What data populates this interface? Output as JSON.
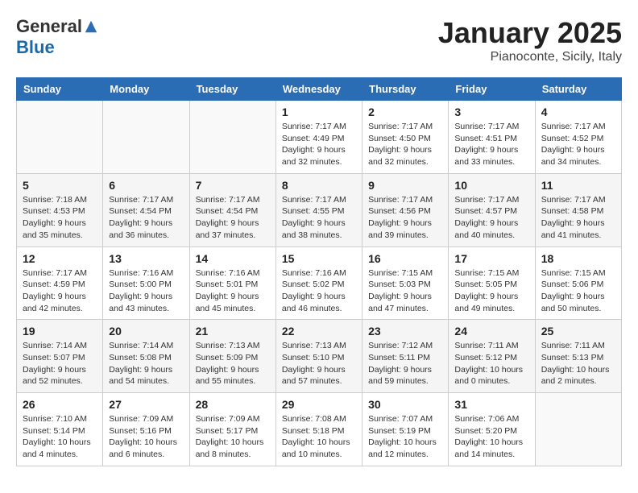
{
  "logo": {
    "general": "General",
    "blue": "Blue"
  },
  "title": "January 2025",
  "subtitle": "Pianoconte, Sicily, Italy",
  "days_of_week": [
    "Sunday",
    "Monday",
    "Tuesday",
    "Wednesday",
    "Thursday",
    "Friday",
    "Saturday"
  ],
  "weeks": [
    [
      {
        "day": "",
        "info": ""
      },
      {
        "day": "",
        "info": ""
      },
      {
        "day": "",
        "info": ""
      },
      {
        "day": "1",
        "info": "Sunrise: 7:17 AM\nSunset: 4:49 PM\nDaylight: 9 hours\nand 32 minutes."
      },
      {
        "day": "2",
        "info": "Sunrise: 7:17 AM\nSunset: 4:50 PM\nDaylight: 9 hours\nand 32 minutes."
      },
      {
        "day": "3",
        "info": "Sunrise: 7:17 AM\nSunset: 4:51 PM\nDaylight: 9 hours\nand 33 minutes."
      },
      {
        "day": "4",
        "info": "Sunrise: 7:17 AM\nSunset: 4:52 PM\nDaylight: 9 hours\nand 34 minutes."
      }
    ],
    [
      {
        "day": "5",
        "info": "Sunrise: 7:18 AM\nSunset: 4:53 PM\nDaylight: 9 hours\nand 35 minutes."
      },
      {
        "day": "6",
        "info": "Sunrise: 7:17 AM\nSunset: 4:54 PM\nDaylight: 9 hours\nand 36 minutes."
      },
      {
        "day": "7",
        "info": "Sunrise: 7:17 AM\nSunset: 4:54 PM\nDaylight: 9 hours\nand 37 minutes."
      },
      {
        "day": "8",
        "info": "Sunrise: 7:17 AM\nSunset: 4:55 PM\nDaylight: 9 hours\nand 38 minutes."
      },
      {
        "day": "9",
        "info": "Sunrise: 7:17 AM\nSunset: 4:56 PM\nDaylight: 9 hours\nand 39 minutes."
      },
      {
        "day": "10",
        "info": "Sunrise: 7:17 AM\nSunset: 4:57 PM\nDaylight: 9 hours\nand 40 minutes."
      },
      {
        "day": "11",
        "info": "Sunrise: 7:17 AM\nSunset: 4:58 PM\nDaylight: 9 hours\nand 41 minutes."
      }
    ],
    [
      {
        "day": "12",
        "info": "Sunrise: 7:17 AM\nSunset: 4:59 PM\nDaylight: 9 hours\nand 42 minutes."
      },
      {
        "day": "13",
        "info": "Sunrise: 7:16 AM\nSunset: 5:00 PM\nDaylight: 9 hours\nand 43 minutes."
      },
      {
        "day": "14",
        "info": "Sunrise: 7:16 AM\nSunset: 5:01 PM\nDaylight: 9 hours\nand 45 minutes."
      },
      {
        "day": "15",
        "info": "Sunrise: 7:16 AM\nSunset: 5:02 PM\nDaylight: 9 hours\nand 46 minutes."
      },
      {
        "day": "16",
        "info": "Sunrise: 7:15 AM\nSunset: 5:03 PM\nDaylight: 9 hours\nand 47 minutes."
      },
      {
        "day": "17",
        "info": "Sunrise: 7:15 AM\nSunset: 5:05 PM\nDaylight: 9 hours\nand 49 minutes."
      },
      {
        "day": "18",
        "info": "Sunrise: 7:15 AM\nSunset: 5:06 PM\nDaylight: 9 hours\nand 50 minutes."
      }
    ],
    [
      {
        "day": "19",
        "info": "Sunrise: 7:14 AM\nSunset: 5:07 PM\nDaylight: 9 hours\nand 52 minutes."
      },
      {
        "day": "20",
        "info": "Sunrise: 7:14 AM\nSunset: 5:08 PM\nDaylight: 9 hours\nand 54 minutes."
      },
      {
        "day": "21",
        "info": "Sunrise: 7:13 AM\nSunset: 5:09 PM\nDaylight: 9 hours\nand 55 minutes."
      },
      {
        "day": "22",
        "info": "Sunrise: 7:13 AM\nSunset: 5:10 PM\nDaylight: 9 hours\nand 57 minutes."
      },
      {
        "day": "23",
        "info": "Sunrise: 7:12 AM\nSunset: 5:11 PM\nDaylight: 9 hours\nand 59 minutes."
      },
      {
        "day": "24",
        "info": "Sunrise: 7:11 AM\nSunset: 5:12 PM\nDaylight: 10 hours\nand 0 minutes."
      },
      {
        "day": "25",
        "info": "Sunrise: 7:11 AM\nSunset: 5:13 PM\nDaylight: 10 hours\nand 2 minutes."
      }
    ],
    [
      {
        "day": "26",
        "info": "Sunrise: 7:10 AM\nSunset: 5:14 PM\nDaylight: 10 hours\nand 4 minutes."
      },
      {
        "day": "27",
        "info": "Sunrise: 7:09 AM\nSunset: 5:16 PM\nDaylight: 10 hours\nand 6 minutes."
      },
      {
        "day": "28",
        "info": "Sunrise: 7:09 AM\nSunset: 5:17 PM\nDaylight: 10 hours\nand 8 minutes."
      },
      {
        "day": "29",
        "info": "Sunrise: 7:08 AM\nSunset: 5:18 PM\nDaylight: 10 hours\nand 10 minutes."
      },
      {
        "day": "30",
        "info": "Sunrise: 7:07 AM\nSunset: 5:19 PM\nDaylight: 10 hours\nand 12 minutes."
      },
      {
        "day": "31",
        "info": "Sunrise: 7:06 AM\nSunset: 5:20 PM\nDaylight: 10 hours\nand 14 minutes."
      },
      {
        "day": "",
        "info": ""
      }
    ]
  ]
}
